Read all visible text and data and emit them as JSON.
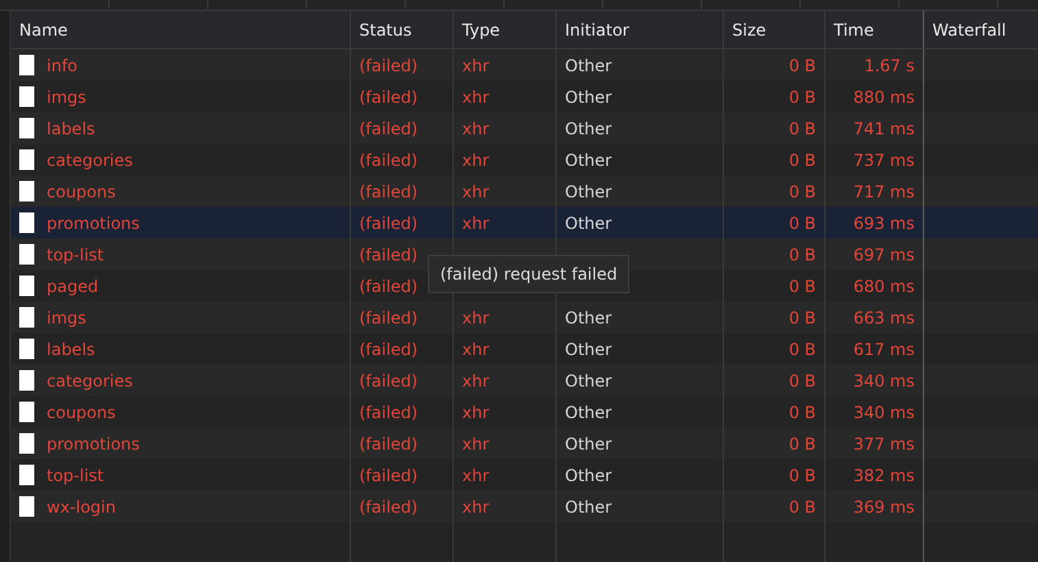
{
  "columns": [
    "Name",
    "Status",
    "Type",
    "Initiator",
    "Size",
    "Time",
    "Waterfall"
  ],
  "rows": [
    {
      "name": "info",
      "status": "(failed)",
      "type": "xhr",
      "initiator": "Other",
      "size": "0 B",
      "time": "1.67 s",
      "selected": false
    },
    {
      "name": "imgs",
      "status": "(failed)",
      "type": "xhr",
      "initiator": "Other",
      "size": "0 B",
      "time": "880 ms",
      "selected": false
    },
    {
      "name": "labels",
      "status": "(failed)",
      "type": "xhr",
      "initiator": "Other",
      "size": "0 B",
      "time": "741 ms",
      "selected": false
    },
    {
      "name": "categories",
      "status": "(failed)",
      "type": "xhr",
      "initiator": "Other",
      "size": "0 B",
      "time": "737 ms",
      "selected": false
    },
    {
      "name": "coupons",
      "status": "(failed)",
      "type": "xhr",
      "initiator": "Other",
      "size": "0 B",
      "time": "717 ms",
      "selected": false
    },
    {
      "name": "promotions",
      "status": "(failed)",
      "type": "xhr",
      "initiator": "Other",
      "size": "0 B",
      "time": "693 ms",
      "selected": true
    },
    {
      "name": "top-list",
      "status": "(failed)",
      "size": "0 B",
      "time": "697 ms",
      "selected": false
    },
    {
      "name": "paged",
      "status": "(failed)",
      "size": "0 B",
      "time": "680 ms",
      "selected": false
    },
    {
      "name": "imgs",
      "status": "(failed)",
      "type": "xhr",
      "initiator": "Other",
      "size": "0 B",
      "time": "663 ms",
      "selected": false
    },
    {
      "name": "labels",
      "status": "(failed)",
      "type": "xhr",
      "initiator": "Other",
      "size": "0 B",
      "time": "617 ms",
      "selected": false
    },
    {
      "name": "categories",
      "status": "(failed)",
      "type": "xhr",
      "initiator": "Other",
      "size": "0 B",
      "time": "340 ms",
      "selected": false
    },
    {
      "name": "coupons",
      "status": "(failed)",
      "type": "xhr",
      "initiator": "Other",
      "size": "0 B",
      "time": "340 ms",
      "selected": false
    },
    {
      "name": "promotions",
      "status": "(failed)",
      "type": "xhr",
      "initiator": "Other",
      "size": "0 B",
      "time": "377 ms",
      "selected": false
    },
    {
      "name": "top-list",
      "status": "(failed)",
      "type": "xhr",
      "initiator": "Other",
      "size": "0 B",
      "time": "382 ms",
      "selected": false
    },
    {
      "name": "wx-login",
      "status": "(failed)",
      "type": "xhr",
      "initiator": "Other",
      "size": "0 B",
      "time": "369 ms",
      "selected": false
    }
  ],
  "tooltip": "(failed) request failed"
}
